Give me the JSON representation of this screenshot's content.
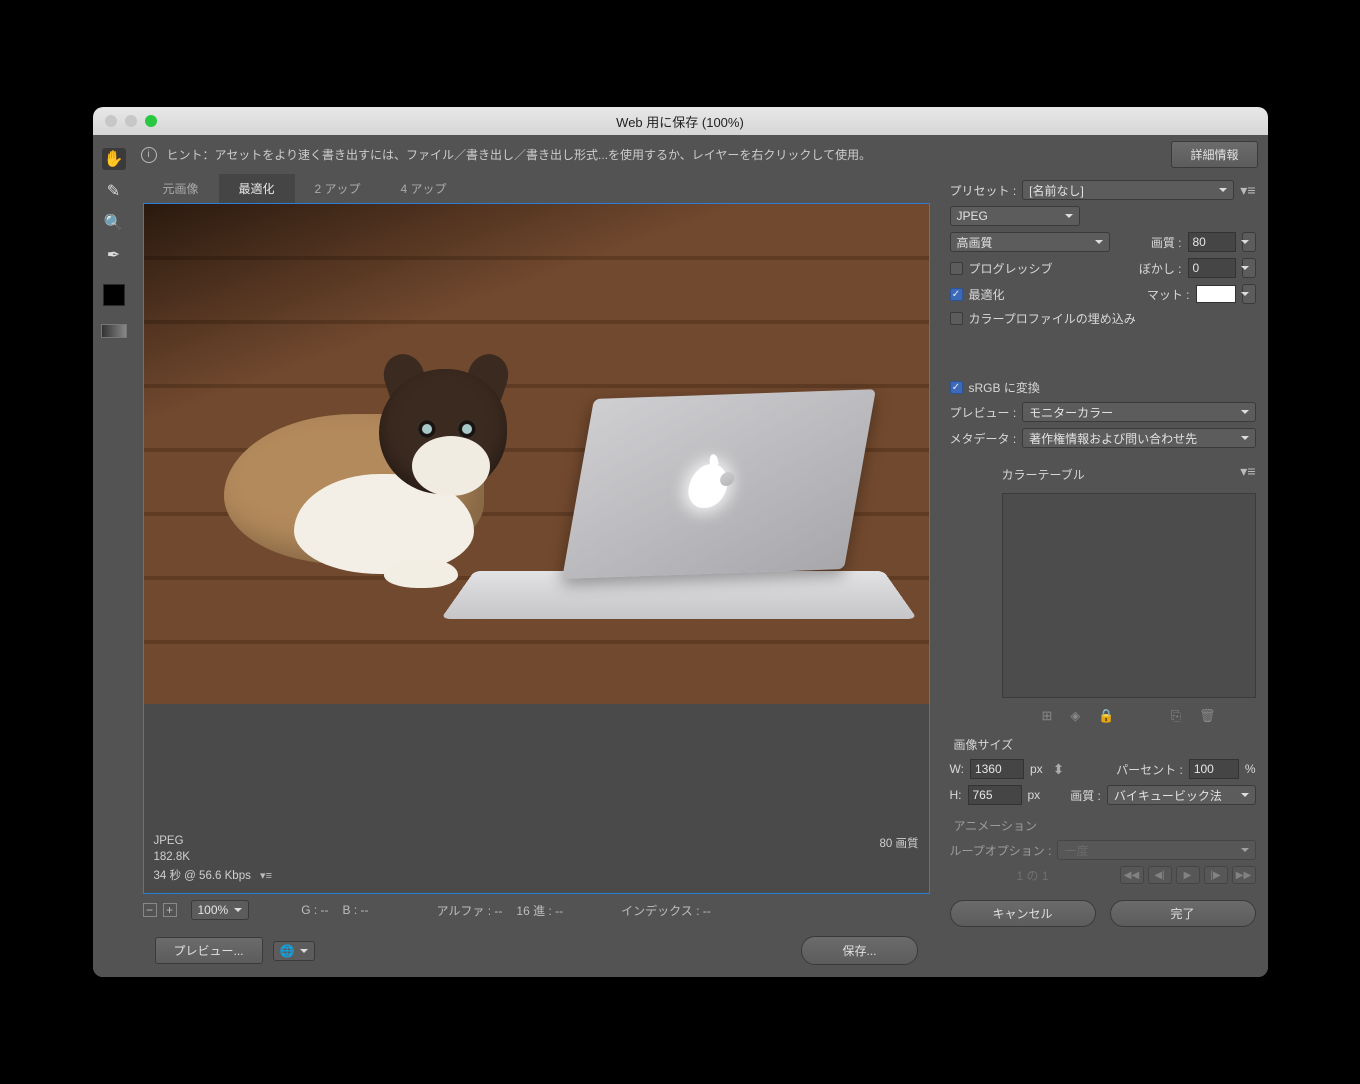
{
  "window": {
    "title": "Web 用に保存 (100%)"
  },
  "hint": {
    "label": "ヒント：アセットをより速く書き出すには、ファイル／書き出し／書き出し形式...を使用するか、レイヤーを右クリックして使用。",
    "details_button": "詳細情報"
  },
  "tabs": {
    "original": "元画像",
    "optimized": "最適化",
    "two_up": "2 アップ",
    "four_up": "4 アップ"
  },
  "preview_info": {
    "format": "JPEG",
    "size": "182.8K",
    "time": "34 秒 @ 56.6 Kbps",
    "quality_label": "80 画質"
  },
  "readouts": {
    "zoom": "100%",
    "g": "G : --",
    "b": "B : --",
    "alpha": "アルファ : --",
    "hex": "16 進 : --",
    "index": "インデックス : --"
  },
  "footer": {
    "preview": "プレビュー...",
    "save": "保存...",
    "cancel": "キャンセル",
    "done": "完了"
  },
  "panel": {
    "preset_label": "プリセット :",
    "preset_value": "[名前なし]",
    "format": "JPEG",
    "quality_preset": "高画質",
    "quality_label": "画質 :",
    "quality_value": "80",
    "progressive": "プログレッシブ",
    "blur_label": "ぼかし :",
    "blur_value": "0",
    "optimized": "最適化",
    "matte_label": "マット :",
    "embed_profile": "カラープロファイルの埋め込み",
    "srgb": "sRGB に変換",
    "preview_label": "プレビュー :",
    "preview_value": "モニターカラー",
    "metadata_label": "メタデータ :",
    "metadata_value": "著作権情報および問い合わせ先",
    "colortable_title": "カラーテーブル",
    "imagesize_title": "画像サイズ",
    "w_label": "W:",
    "w_value": "1360",
    "px": "px",
    "h_label": "H:",
    "h_value": "765",
    "percent_label": "パーセント :",
    "percent_value": "100",
    "percent_unit": "%",
    "resample_label": "画質 :",
    "resample_value": "バイキュービック法",
    "anim_title": "アニメーション",
    "loop_label": "ループオプション :",
    "loop_value": "一度",
    "frame": "1 の 1"
  }
}
